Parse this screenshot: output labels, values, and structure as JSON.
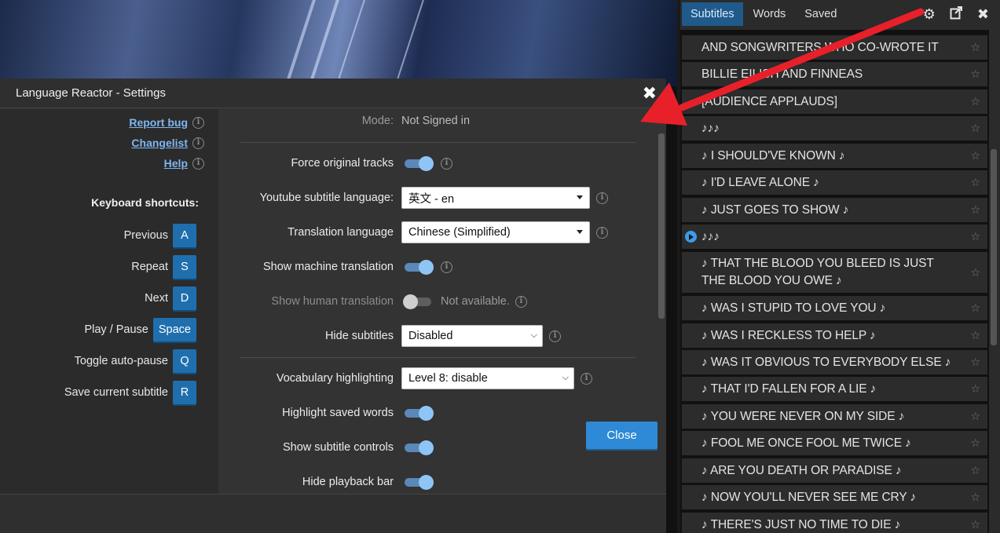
{
  "dialog": {
    "title": "Language Reactor - Settings",
    "close_label": "Close",
    "links": [
      {
        "label": "Report bug"
      },
      {
        "label": "Changelist"
      },
      {
        "label": "Help"
      }
    ],
    "shortcuts_title": "Keyboard shortcuts:",
    "shortcuts": [
      {
        "label": "Previous",
        "key": "A"
      },
      {
        "label": "Repeat",
        "key": "S"
      },
      {
        "label": "Next",
        "key": "D"
      },
      {
        "label": "Play / Pause",
        "key": "Space"
      },
      {
        "label": "Toggle auto-pause",
        "key": "Q"
      },
      {
        "label": "Save current subtitle",
        "key": "R"
      }
    ],
    "mode_label": "Mode:",
    "mode_value": "Not Signed in",
    "settings": {
      "force_original_tracks": {
        "label": "Force original tracks",
        "enabled": true
      },
      "youtube_subtitle_language": {
        "label": "Youtube subtitle language:",
        "value": "英文 - en"
      },
      "translation_language": {
        "label": "Translation language",
        "value": "Chinese (Simplified)"
      },
      "show_machine_translation": {
        "label": "Show machine translation",
        "enabled": true
      },
      "show_human_translation": {
        "label": "Show human translation",
        "enabled": false,
        "note": "Not available."
      },
      "hide_subtitles": {
        "label": "Hide subtitles",
        "value": "Disabled"
      },
      "vocabulary_highlighting": {
        "label": "Vocabulary highlighting",
        "value": "Level 8: disable"
      },
      "highlight_saved_words": {
        "label": "Highlight saved words",
        "enabled": true
      },
      "show_subtitle_controls": {
        "label": "Show subtitle controls",
        "enabled": true
      },
      "hide_playback_bar": {
        "label": "Hide playback bar",
        "enabled": true
      }
    }
  },
  "panel": {
    "tabs": [
      {
        "label": "Subtitles",
        "active": true
      },
      {
        "label": "Words",
        "active": false
      },
      {
        "label": "Saved",
        "active": false
      }
    ],
    "icons": [
      "gear-icon",
      "export-icon",
      "close-icon"
    ],
    "subtitles": [
      "AND SONGWRITERS WHO CO-WROTE IT",
      "BILLIE EILISH AND FINNEAS",
      "[AUDIENCE APPLAUDS]",
      "♪♪♪",
      "♪ I SHOULD'VE KNOWN ♪",
      "♪ I'D LEAVE ALONE ♪",
      "♪ JUST GOES TO SHOW ♪",
      "♪♪♪",
      "♪ THAT THE BLOOD YOU BLEED IS JUST THE BLOOD YOU OWE ♪",
      "♪ WAS I STUPID TO LOVE YOU ♪",
      "♪ WAS I RECKLESS TO HELP ♪",
      "♪ WAS IT OBVIOUS TO EVERYBODY ELSE ♪",
      "♪ THAT I'D FALLEN FOR A LIE ♪",
      "♪ YOU WERE NEVER ON MY SIDE ♪",
      "♪ FOOL ME ONCE FOOL ME TWICE ♪",
      "♪ ARE YOU DEATH OR PARADISE ♪",
      "♪ NOW YOU'LL NEVER SEE ME CRY ♪",
      "♪ THERE'S JUST NO TIME TO DIE ♪"
    ],
    "current_index": 7
  },
  "colors": {
    "accent": "#2e8ad6",
    "toggle_on": "#8fc5f5",
    "link": "#7fb6f0",
    "arrow": "#e8202a"
  }
}
